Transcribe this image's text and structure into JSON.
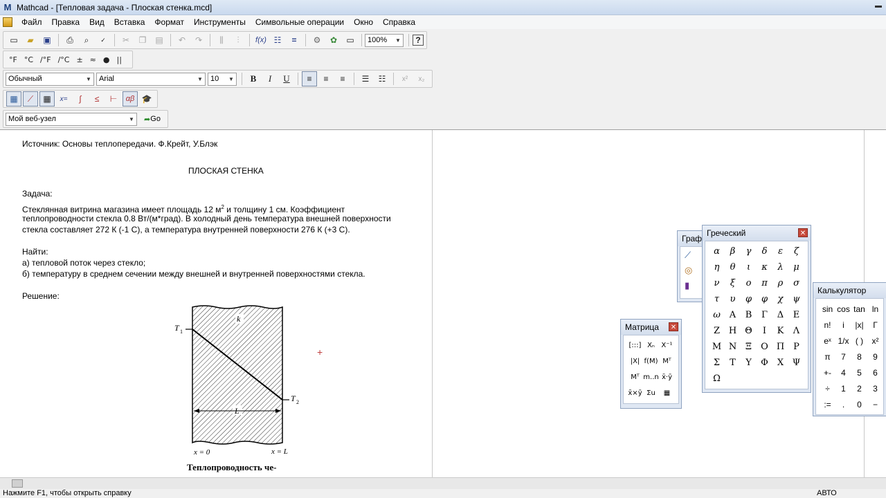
{
  "window": {
    "title": "Mathcad - [Тепловая задача - Плоская стенка.mcd]",
    "app_letter": "M"
  },
  "menu": [
    "Файл",
    "Правка",
    "Вид",
    "Вставка",
    "Формат",
    "Инструменты",
    "Символьные операции",
    "Окно",
    "Справка"
  ],
  "toolbar": {
    "zoom": "100%",
    "help_label": "?"
  },
  "units_toolbar": [
    "°F",
    "°C",
    "/°F",
    "/°C",
    "±",
    "≈",
    "●",
    "||"
  ],
  "format_toolbar": {
    "style": "Обычный",
    "font": "Arial",
    "size": "10",
    "bold": "B",
    "italic": "I",
    "underline": "U"
  },
  "math_toolbar": {
    "greek_label": "αβ",
    "eval_label": "x="
  },
  "web_toolbar": {
    "address": "Мой веб-узел",
    "go_label": "Go"
  },
  "document": {
    "source": "Источник: Основы теплопередачи. Ф.Крейт, У.Блэк",
    "heading": "ПЛОСКАЯ СТЕНКА",
    "task_label": "Задача:",
    "task_line1_a": "Стеклянная витрина магазина  имеет площадь 12 м",
    "task_line1_sup": "2",
    "task_line1_b": " и толщину 1 см. Коэффициент",
    "task_line2": "теплопроводности стекла 0.8 Вт/(м*град). В холодный день температура внешней поверхности",
    "task_line3": "стекла составляет 272 К (-1 С), а температура внутренней поверхности 276 К (+3 С).",
    "find_label": "Найти:",
    "find_a": "а) тепловой поток через стекло;",
    "find_b": "б) температуру в среднем сечении между внешней и внутренней поверхностями стекла.",
    "solution_label": "Решение:",
    "figure": {
      "t1": "T",
      "t1_sub": "1",
      "t2": "T",
      "t2_sub": "2",
      "k": "k",
      "L": "L",
      "x0": "x = 0",
      "xL": "x = L"
    },
    "caption": "Теплопроводность  че-"
  },
  "palettes": {
    "greek": {
      "title": "Греческий",
      "symbols": [
        "α",
        "β",
        "γ",
        "δ",
        "ε",
        "ζ",
        "η",
        "θ",
        "ι",
        "κ",
        "λ",
        "μ",
        "ν",
        "ξ",
        "ο",
        "π",
        "ρ",
        "σ",
        "τ",
        "υ",
        "φ",
        "φ",
        "χ",
        "ψ",
        "ω",
        "Α",
        "Β",
        "Γ",
        "Δ",
        "Ε",
        "Ζ",
        "Η",
        "Θ",
        "Ι",
        "Κ",
        "Λ",
        "Μ",
        "Ν",
        "Ξ",
        "Ο",
        "Π",
        "Ρ",
        "Σ",
        "Τ",
        "Υ",
        "Φ",
        "Χ",
        "Ψ",
        "Ω"
      ]
    },
    "graph": {
      "title": "Граф"
    },
    "matrix": {
      "title": "Матрица",
      "symbols": [
        "[:::]",
        "Xₙ",
        "X⁻¹",
        "|X|",
        "f(M)",
        "Mᵀ",
        "Mᵀ",
        "m..n",
        "x̄·ȳ",
        "x̄×ȳ",
        "Σu",
        "▦"
      ]
    },
    "calculator": {
      "title": "Калькулятор",
      "symbols": [
        "sin",
        "cos",
        "tan",
        "ln",
        "n!",
        "i",
        "|x|",
        "Γ",
        "eˣ",
        "1/x",
        "( )",
        "x²",
        "π",
        "7",
        "8",
        "9",
        "+-",
        "4",
        "5",
        "6",
        "÷",
        "1",
        "2",
        "3",
        ":=",
        ".",
        "0",
        "−"
      ]
    }
  },
  "status": {
    "left": "Нажмите F1, чтобы открыть справку",
    "right": "АВТО"
  }
}
